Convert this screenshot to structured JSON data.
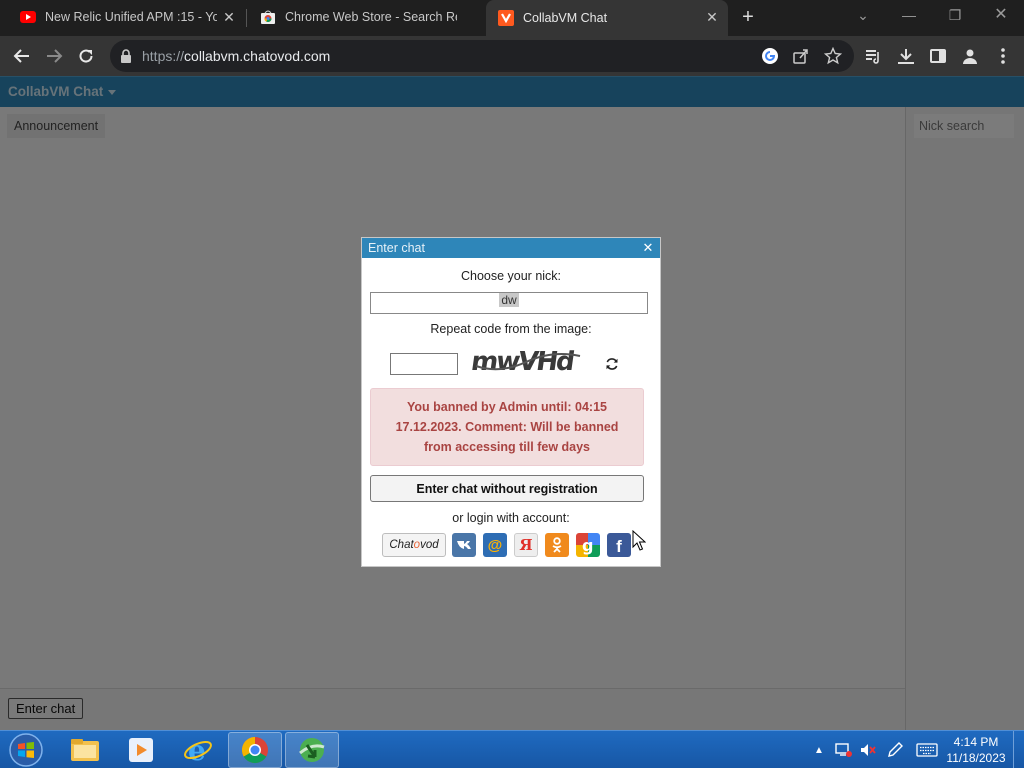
{
  "browser": {
    "tabs": [
      {
        "title": "New Relic Unified APM :15 - You",
        "favicon": "youtube-icon"
      },
      {
        "title": "Chrome Web Store - Search Res",
        "favicon": "chrome-web-store-icon"
      },
      {
        "title": "CollabVM Chat",
        "favicon": "chatovod-icon",
        "active": true
      }
    ],
    "url_scheme": "https://",
    "url_host": "collabvm.chatovod.com"
  },
  "app": {
    "brand": "CollabVM Chat",
    "announcement_label": "Announcement",
    "nick_search_placeholder": "Nick search",
    "enter_chat_label": "Enter chat"
  },
  "modal": {
    "title": "Enter chat",
    "nick_label": "Choose your nick:",
    "nick_value": "dw",
    "captcha_label": "Repeat code from the image:",
    "captcha_text": "mwVHd",
    "error_message": "You banned by Admin until: 04:15 17.12.2023. Comment: Will be banned from accessing till few days",
    "enter_button": "Enter chat without registration",
    "login_label": "or login with account:",
    "providers": [
      "Chatovod",
      "VK",
      "Mail.ru",
      "Yandex",
      "Odnoklassniki",
      "Google",
      "Facebook"
    ]
  },
  "taskbar": {
    "time": "4:14 PM",
    "date": "11/18/2023"
  },
  "colors": {
    "header_blue": "#2e86b9",
    "error_bg": "#f2dede",
    "error_text": "#a94442",
    "taskbar_blue": "#1f6ac0"
  }
}
